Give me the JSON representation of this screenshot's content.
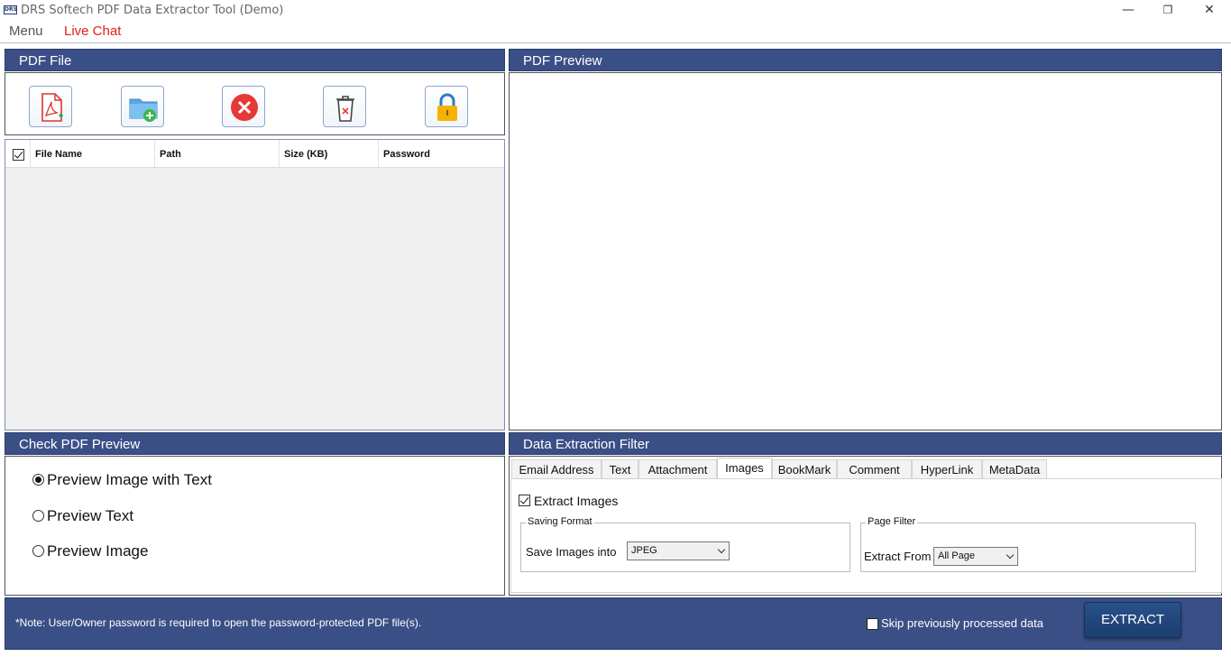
{
  "window": {
    "logo_text": "DRS",
    "title": "DRS Softech PDF Data Extractor Tool (Demo)",
    "minimize": "—",
    "restore": "❐",
    "close": "✕"
  },
  "menu": {
    "items": [
      "Menu",
      "Live Chat"
    ]
  },
  "pdf_file": {
    "header": "PDF File",
    "toolbar": [
      "add-pdf-icon",
      "add-folder-icon",
      "remove-icon",
      "delete-all-icon",
      "unlock-icon"
    ],
    "columns": [
      "File Name",
      "Path",
      "Size (KB)",
      "Password"
    ],
    "rows": []
  },
  "pdf_preview": {
    "header": "PDF Preview"
  },
  "check_preview": {
    "header": "Check PDF Preview",
    "options": [
      "Preview Image with Text",
      "Preview Text",
      "Preview Image"
    ],
    "selected": "Preview Image with Text"
  },
  "filter": {
    "header": "Data Extraction Filter",
    "tabs": [
      "Email Address",
      "Text",
      "Attachment",
      "Images",
      "BookMark",
      "Comment",
      "HyperLink",
      "MetaData"
    ],
    "active_tab": "Images",
    "extract_images_label": "Extract Images",
    "extract_images_checked": true,
    "saving_format": {
      "title": "Saving Format",
      "label": "Save Images into",
      "value": "JPEG"
    },
    "page_filter": {
      "title": "Page Filter",
      "label": "Extract From",
      "value": "All Page"
    }
  },
  "footer": {
    "note": "*Note: User/Owner password is required to open the password-protected PDF file(s).",
    "skip_label": "Skip previously processed data",
    "skip_checked": false,
    "extract_label": "EXTRACT"
  },
  "colors": {
    "panel_header": "#3b4f87",
    "live_chat": "#e0201c",
    "extract_button": "#1f4478"
  }
}
